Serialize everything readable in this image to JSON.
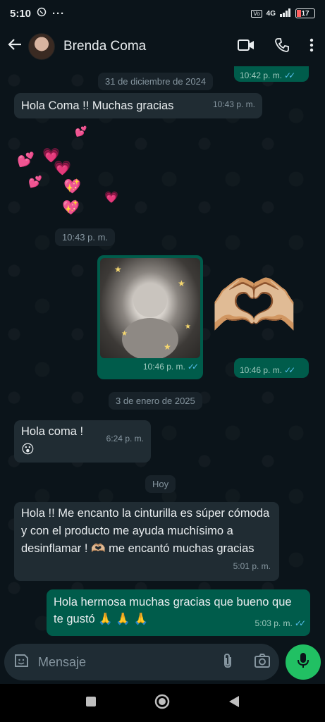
{
  "status_bar": {
    "time": "5:10",
    "network": "4G",
    "battery": "17"
  },
  "header": {
    "contact_name": "Brenda Coma"
  },
  "messages": {
    "top_out_time": "10:42 p. m.",
    "date1": "31 de diciembre de 2024",
    "m1_text": "Hola Coma !!  Muchas gracias",
    "m1_time": "10:43 p. m.",
    "sticker_time": "10:43 p. m.",
    "photo_time": "10:46 p. m.",
    "heart_time": "10:46 p. m.",
    "date2": "3 de enero de 2025",
    "m2_text": "Hola coma !",
    "m2_time": "6:24 p. m.",
    "m2_emoji": "😮",
    "date3": "Hoy",
    "m3_text": "Hola !! Me encanto la cinturilla es súper cómoda y con el producto me ayuda muchísimo a desinflamar ! 🫶🏼 me encantó muchas gracias",
    "m3_time": "5:01 p. m.",
    "m4_text": "Hola hermosa muchas gracias que bueno que te gustó 🙏 🙏 🙏",
    "m4_time": "5:03 p. m."
  },
  "input": {
    "placeholder": "Mensaje"
  },
  "icons": {
    "heart_hands": "🫶🏼",
    "colors": {
      "incoming": "#202c33",
      "outgoing": "#005c4b",
      "accent": "#21c063",
      "read_ticks": "#53bdeb"
    }
  }
}
